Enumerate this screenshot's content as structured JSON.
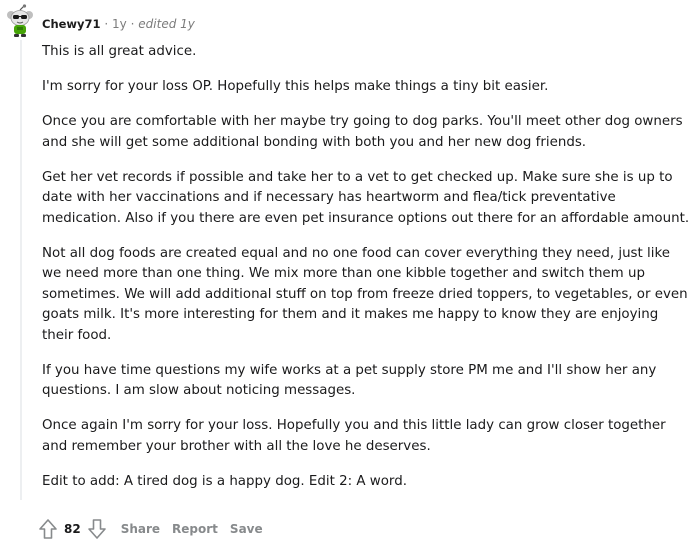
{
  "comment": {
    "username": "Chewy71",
    "dot": "·",
    "age": "1y",
    "edited": "edited 1y",
    "paragraphs": [
      "This is all great advice.",
      "I'm sorry for your loss OP. Hopefully this helps make things a tiny bit easier.",
      "Once you are comfortable with her maybe try going to dog parks. You'll meet other dog owners and she will get some additional bonding with both you and her new dog friends.",
      "Get her vet records if possible and take her to a vet to get checked up. Make sure she is up to date with her vaccinations and if necessary has heartworm and flea/tick preventative medication. Also if you there are even pet insurance options out there for an affordable amount.",
      "Not all dog foods are created equal and no one food can cover everything they need, just like we need more than one thing. We mix more than one kibble together and switch them up sometimes. We will add additional stuff on top from freeze dried toppers, to vegetables, or even goats milk. It's more interesting for them and it makes me happy to know they are enjoying their food.",
      "If you have time questions my wife works at a pet supply store PM me and I'll show her any questions. I am slow about noticing messages.",
      "Once again I'm sorry for your loss. Hopefully you and this little lady can grow closer together and remember your brother with all the love he deserves.",
      "Edit to add: A tired dog is a happy dog. Edit 2: A word."
    ],
    "score": "82",
    "actions": {
      "share": "Share",
      "report": "Report",
      "save": "Save"
    }
  },
  "icons": {
    "avatar": "snoo-avatar-icon",
    "upvote": "upvote-arrow-icon",
    "downvote": "downvote-arrow-icon"
  },
  "colors": {
    "text": "#1a1a1b",
    "meta": "#7c7c7c",
    "action": "#878a8c",
    "thread_line": "#edeff1",
    "avatar_green": "#46a508"
  }
}
